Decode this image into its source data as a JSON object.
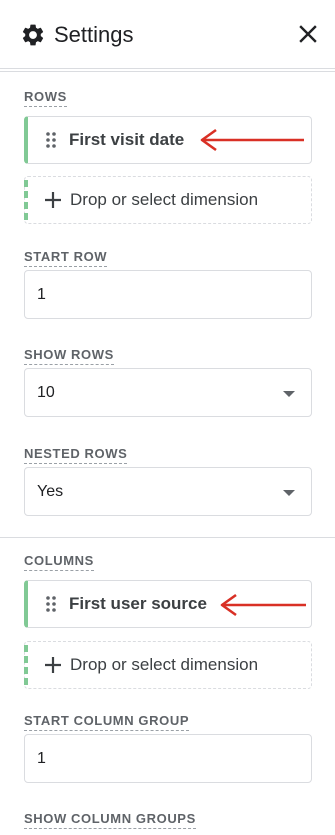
{
  "header": {
    "title": "Settings"
  },
  "rows": {
    "label": "ROWS",
    "dimension": "First visit date",
    "add_label": "Drop or select dimension"
  },
  "start_row": {
    "label": "START ROW",
    "value": "1"
  },
  "show_rows": {
    "label": "SHOW ROWS",
    "value": "10"
  },
  "nested_rows": {
    "label": "NESTED ROWS",
    "value": "Yes"
  },
  "columns": {
    "label": "COLUMNS",
    "dimension": "First user source",
    "add_label": "Drop or select dimension"
  },
  "start_column_group": {
    "label": "START COLUMN GROUP",
    "value": "1"
  },
  "show_column_groups": {
    "label": "SHOW COLUMN GROUPS"
  },
  "colors": {
    "accent_green": "#81c995",
    "annotation_red": "#d93025"
  }
}
